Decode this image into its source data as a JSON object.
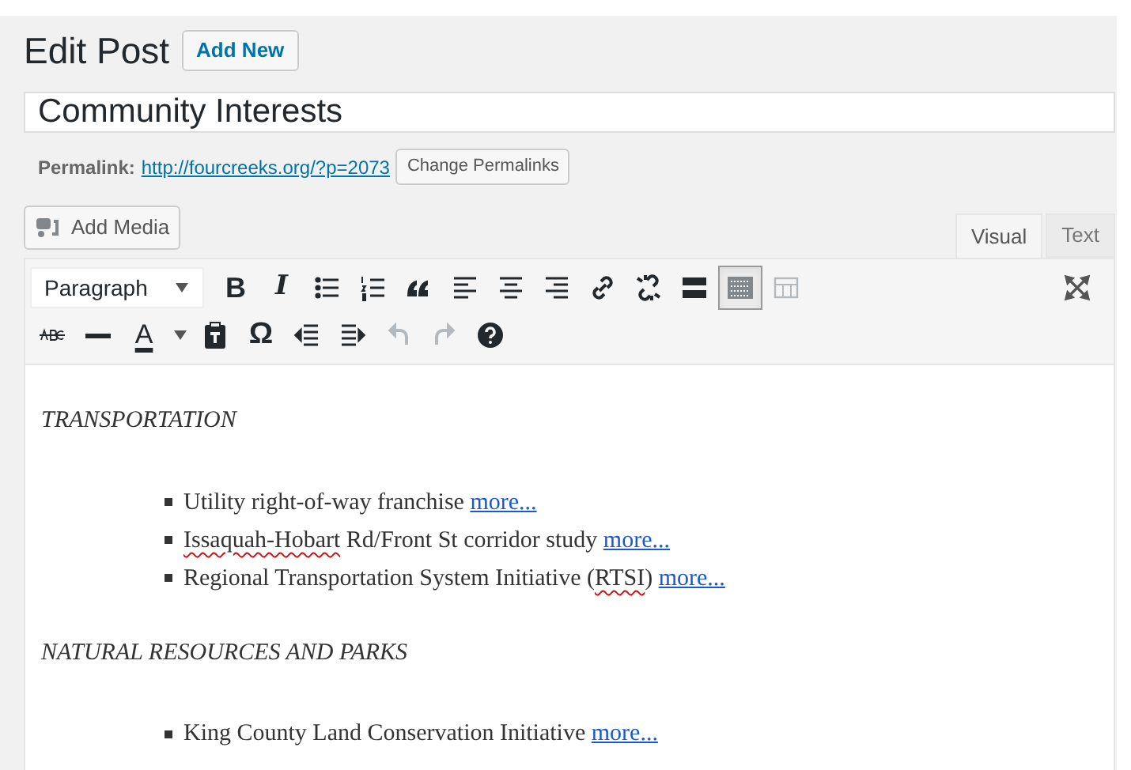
{
  "heading": {
    "title": "Edit Post",
    "add_new": "Add New"
  },
  "post_title": {
    "value": "Community Interests"
  },
  "permalink": {
    "label": "Permalink:",
    "url": "http://fourcreeks.org/?p=2073",
    "button": "Change Permalinks"
  },
  "add_media": "Add Media",
  "editor_tabs": [
    {
      "label": "Visual",
      "selected": true
    },
    {
      "label": "Text",
      "selected": false
    }
  ],
  "toolbar": {
    "format_select": "Paragraph",
    "row_1": [
      {
        "glyph": "B",
        "pressed": false,
        "disabled": false
      },
      {
        "glyph": "I",
        "pressed": false,
        "disabled": false
      },
      {
        "pressed": false,
        "disabled": false
      },
      {
        "pressed": false,
        "disabled": false
      },
      {
        "pressed": false,
        "disabled": false
      },
      {
        "pressed": false,
        "disabled": false
      },
      {
        "pressed": false,
        "disabled": false
      },
      {
        "pressed": false,
        "disabled": false
      },
      {
        "pressed": false,
        "disabled": false
      },
      {
        "pressed": false,
        "disabled": false
      },
      {
        "pressed": false,
        "disabled": false
      },
      {
        "pressed": true,
        "disabled": false
      },
      {
        "pressed": false,
        "disabled": true
      }
    ],
    "row_2": [
      {
        "pressed": false,
        "disabled": false
      },
      {
        "pressed": false,
        "disabled": false
      },
      {
        "glyph": "A",
        "pressed": false,
        "disabled": false
      },
      {
        "pressed": false,
        "disabled": false
      },
      {
        "pressed": false,
        "disabled": false
      },
      {
        "glyph": "Ω",
        "pressed": false,
        "disabled": false
      },
      {
        "pressed": false,
        "disabled": false
      },
      {
        "pressed": false,
        "disabled": false
      },
      {
        "pressed": false,
        "disabled": true
      },
      {
        "pressed": false,
        "disabled": true
      },
      {
        "pressed": false,
        "disabled": false
      }
    ]
  },
  "content": [
    {
      "kind": "heading",
      "text": "TRANSPORTATION"
    },
    {
      "kind": "list",
      "items": [
        {
          "parts": [
            {
              "text": "Utility right-of-way franchise",
              "misspelled": false
            }
          ],
          "link": "more..."
        },
        {
          "parts": [
            {
              "text": "Issaquah-Hobart",
              "misspelled": true
            },
            {
              "text": " Rd/Front St corridor study",
              "misspelled": false
            }
          ],
          "link": "more..."
        },
        {
          "parts": [
            {
              "text": "Regional Transportation System Initiative (",
              "misspelled": false
            },
            {
              "text": "RTSI",
              "misspelled": true
            },
            {
              "text": ")",
              "misspelled": false
            }
          ],
          "link": "more..."
        }
      ]
    },
    {
      "kind": "heading",
      "text": "NATURAL RESOURCES AND PARKS"
    },
    {
      "kind": "list",
      "items": [
        {
          "parts": [
            {
              "text": "King County Land Conservation Initiative",
              "misspelled": false
            }
          ],
          "link": "more..."
        }
      ]
    }
  ]
}
